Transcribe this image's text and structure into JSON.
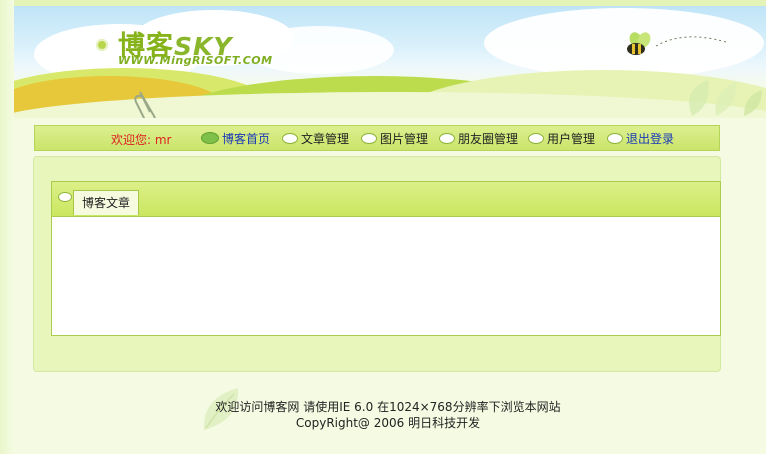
{
  "header": {
    "logo_main": "博客",
    "logo_sky": "SKY",
    "logo_sub": "WWW.MingRISOFT.COM"
  },
  "nav": {
    "welcome_label": "欢迎您: mr",
    "items": [
      {
        "label": "博客首页",
        "active": true
      },
      {
        "label": "文章管理"
      },
      {
        "label": "图片管理"
      },
      {
        "label": "朋友圈管理"
      },
      {
        "label": "用户管理"
      },
      {
        "label": "退出登录"
      }
    ]
  },
  "panel": {
    "tab_label": "博客文章"
  },
  "footer": {
    "line1": "欢迎访问博客网 请使用IE 6.0 在1024×768分辨率下浏览本网站",
    "line2": "CopyRight@ 2006 明日科技开发"
  },
  "colors": {
    "accent_green": "#cae760",
    "welcome_red": "#dd2222",
    "link_blue": "#1838b8"
  },
  "icons": [
    "pill-bullet-icon",
    "paperclip-icon",
    "bee-icon",
    "leaf-icon"
  ]
}
